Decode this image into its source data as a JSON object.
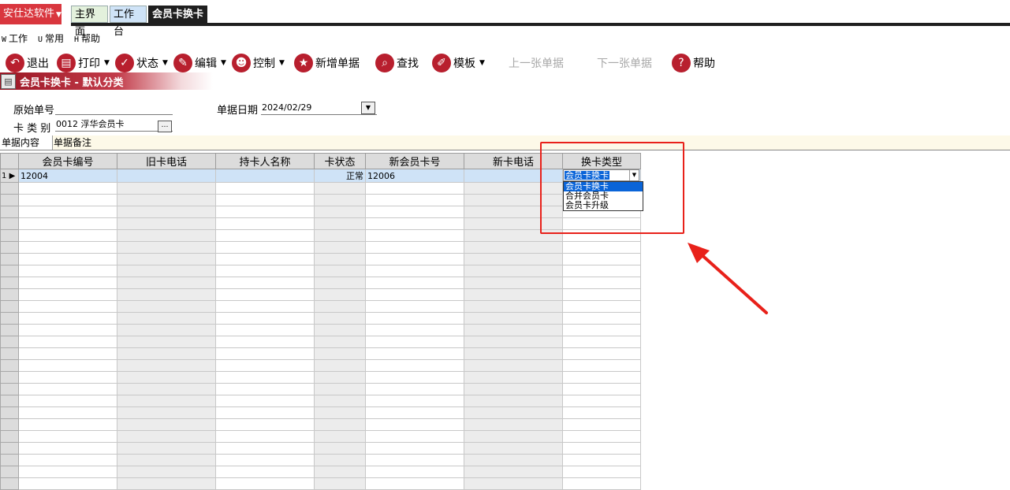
{
  "topbar": {
    "brand": "安仕达软件",
    "tabs": [
      "主界面",
      "工作台",
      "会员卡换卡"
    ]
  },
  "menu": [
    {
      "key": "W",
      "label": "工作"
    },
    {
      "key": "U",
      "label": "常用"
    },
    {
      "key": "H",
      "label": "帮助"
    }
  ],
  "toolbar": {
    "exit": "退出",
    "print": "打印",
    "status": "状态",
    "edit": "编辑",
    "control": "控制",
    "new": "新增单据",
    "find": "查找",
    "template": "模板",
    "prev": "上一张单据",
    "next": "下一张单据",
    "help": "帮助"
  },
  "banner": {
    "title": "会员卡换卡 - 默认分类"
  },
  "form": {
    "orig_no_label": "原始单号",
    "orig_no_value": "",
    "card_type_label": "卡 类 别",
    "card_type_value": "0012 浮华会员卡",
    "date_label": "单据日期",
    "date_value": "2024/02/29"
  },
  "subtabs": [
    "单据内容",
    "单据备注"
  ],
  "grid": {
    "columns": [
      "会员卡编号",
      "旧卡电话",
      "持卡人名称",
      "卡状态",
      "新会员卡号",
      "新卡电话",
      "换卡类型"
    ],
    "row": {
      "num": "1",
      "card_no": "12004",
      "old_phone": "",
      "holder": "",
      "status": "正常",
      "new_card_no": "12006",
      "new_phone": ""
    }
  },
  "dropdown": {
    "selected": "会员卡换卡",
    "options": [
      "会员卡换卡",
      "合并会员卡",
      "会员卡升级"
    ]
  },
  "colors": {
    "brand": "#d9363e",
    "icon": "#b81f2e",
    "annotation": "#e8211a",
    "selection": "#0a64d8"
  }
}
